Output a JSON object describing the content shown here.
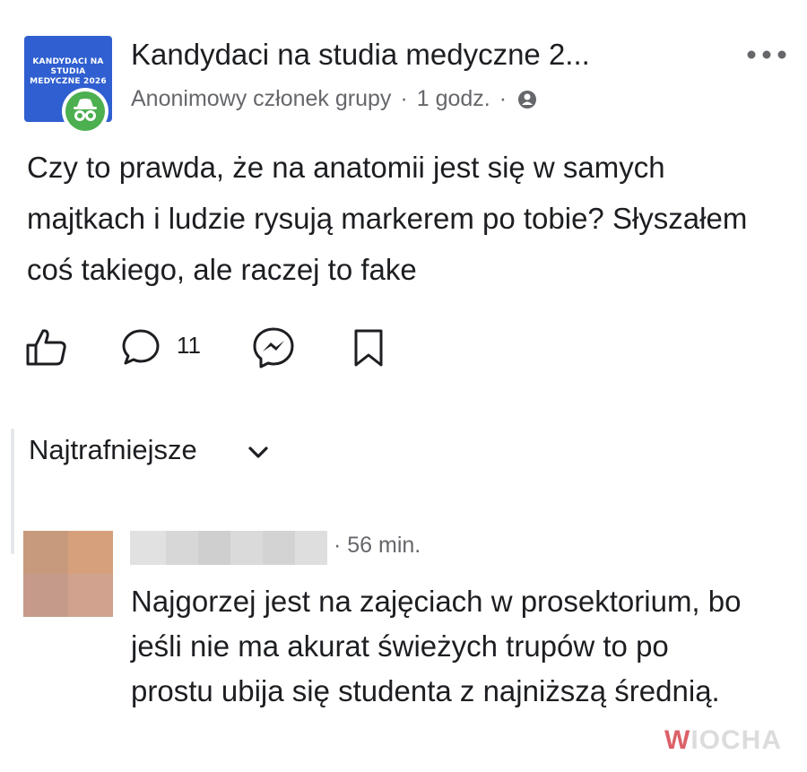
{
  "post": {
    "group_name": "Kandydaci na studia medyczne 2...",
    "group_logo_text": "KANDYDACI NA STUDIA MEDYCZNE 2026",
    "author": "Anonimowy członek grupy",
    "separator": "·",
    "time": "1 godz.",
    "text": "Czy to prawda, że na anatomii jest się w samych majtkach i ludzie rysują markerem po tobie? Słyszałem coś takiego, ale raczej to fake"
  },
  "actions": {
    "comment_count": "11",
    "icons": [
      "like-icon",
      "comment-icon",
      "messenger-icon",
      "save-icon"
    ]
  },
  "comments_section": {
    "sort_label": "Najtrafniejsze",
    "comments": [
      {
        "author": "",
        "time": "· 56 min.",
        "text": "Najgorzej jest na zajęciach w prosektorium, bo jeśli nie ma akurat świeżych trupów to po prostu ubija się studenta z najniższą średnią."
      }
    ]
  },
  "watermark": {
    "first": "W",
    "rest": "IOCHA"
  },
  "colors": {
    "group_blue": "#2f5fd0",
    "anon_green": "#4caf50",
    "secondary_text": "#65676b",
    "watermark_red": "#d64550"
  }
}
